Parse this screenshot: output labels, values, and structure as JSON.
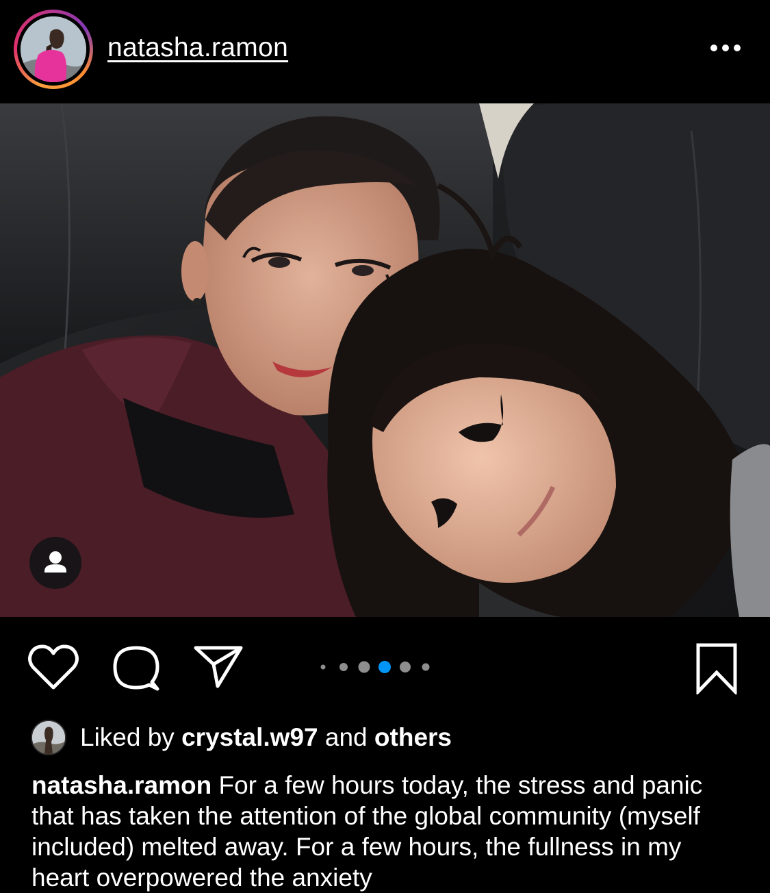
{
  "post": {
    "username": "natasha.ramon",
    "more_label": "•••",
    "photo_alt": "Post photo",
    "carousel": {
      "total": 6,
      "active_index": 3
    }
  },
  "likes": {
    "prefix": "Liked by",
    "user": "crystal.w97",
    "and": "and",
    "others": "others"
  },
  "caption": {
    "username": "natasha.ramon",
    "text": "For a few hours today, the stress and panic that has taken the attention of the global community (myself included) melted away. For a few hours, the fullness in my heart overpowered the anxiety"
  },
  "colors": {
    "background": "#000000",
    "text": "#ffffff",
    "dot_active": "#0095f6",
    "dot_inactive": "#8e8e8e"
  },
  "icons": {
    "more": "more-horizontal-icon",
    "tag": "user-tag-icon",
    "like": "heart-icon",
    "comment": "comment-bubble-icon",
    "share": "paper-plane-icon",
    "save": "bookmark-icon"
  }
}
